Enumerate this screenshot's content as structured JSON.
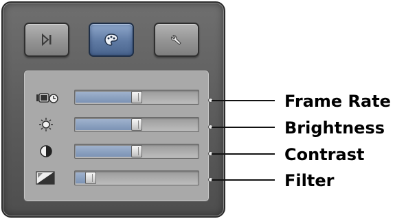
{
  "tabs": [
    {
      "icon": "play-next-icon",
      "active": false
    },
    {
      "icon": "palette-icon",
      "active": true
    },
    {
      "icon": "wrench-icon",
      "active": false
    }
  ],
  "sliders": [
    {
      "icon": "camera-clock-icon",
      "value": 0.5,
      "label": "Frame Rate"
    },
    {
      "icon": "sun-icon",
      "value": 0.5,
      "label": "Brightness"
    },
    {
      "icon": "contrast-icon",
      "value": 0.5,
      "label": "Contrast"
    },
    {
      "icon": "filter-icon",
      "value": 0.08,
      "label": "Filter"
    }
  ],
  "colors": {
    "accent": "#5f7aa3",
    "panel": "#5b5b5b",
    "track_fill": "#8aa0c0"
  }
}
